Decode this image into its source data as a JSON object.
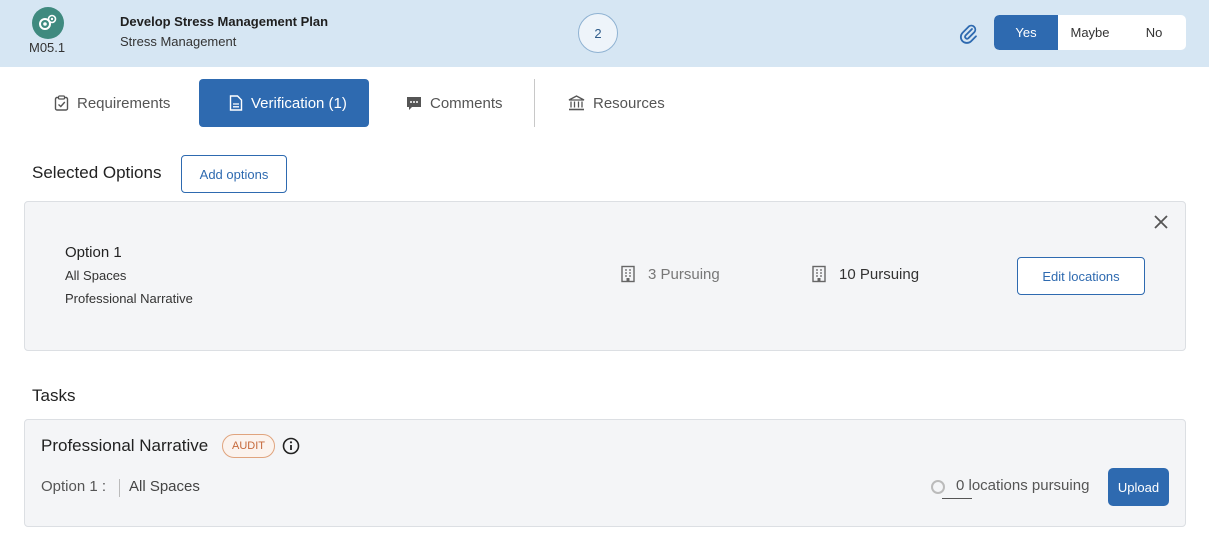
{
  "header": {
    "code": "M05.1",
    "title": "Develop Stress Management Plan",
    "subtitle": "Stress Management",
    "count": "2",
    "answer_options": [
      "Yes",
      "Maybe",
      "No"
    ],
    "selected_answer": "Yes"
  },
  "tabs": [
    {
      "label": "Requirements",
      "icon": "clipboard-check-icon"
    },
    {
      "label": "Verification (1)",
      "icon": "document-icon",
      "active": true
    },
    {
      "label": "Comments",
      "icon": "comment-icon"
    },
    {
      "label": "Resources",
      "icon": "bank-icon"
    }
  ],
  "selected_options": {
    "title": "Selected Options",
    "add_button": "Add options",
    "option": {
      "name": "Option 1",
      "scope": "All Spaces",
      "type": "Professional Narrative",
      "pursuing_a": "3 Pursuing",
      "pursuing_b": "10 Pursuing",
      "edit_button": "Edit locations"
    }
  },
  "tasks": {
    "title": "Tasks",
    "item": {
      "name": "Professional Narrative",
      "badge": "AUDIT",
      "option_label": "Option 1 :",
      "option_value": "All Spaces",
      "locations": "0 locations pursuing",
      "upload_button": "Upload"
    }
  },
  "colors": {
    "header_bg": "#d6e6f3",
    "accent": "#2e6ab0",
    "badge": "#c5683a"
  }
}
